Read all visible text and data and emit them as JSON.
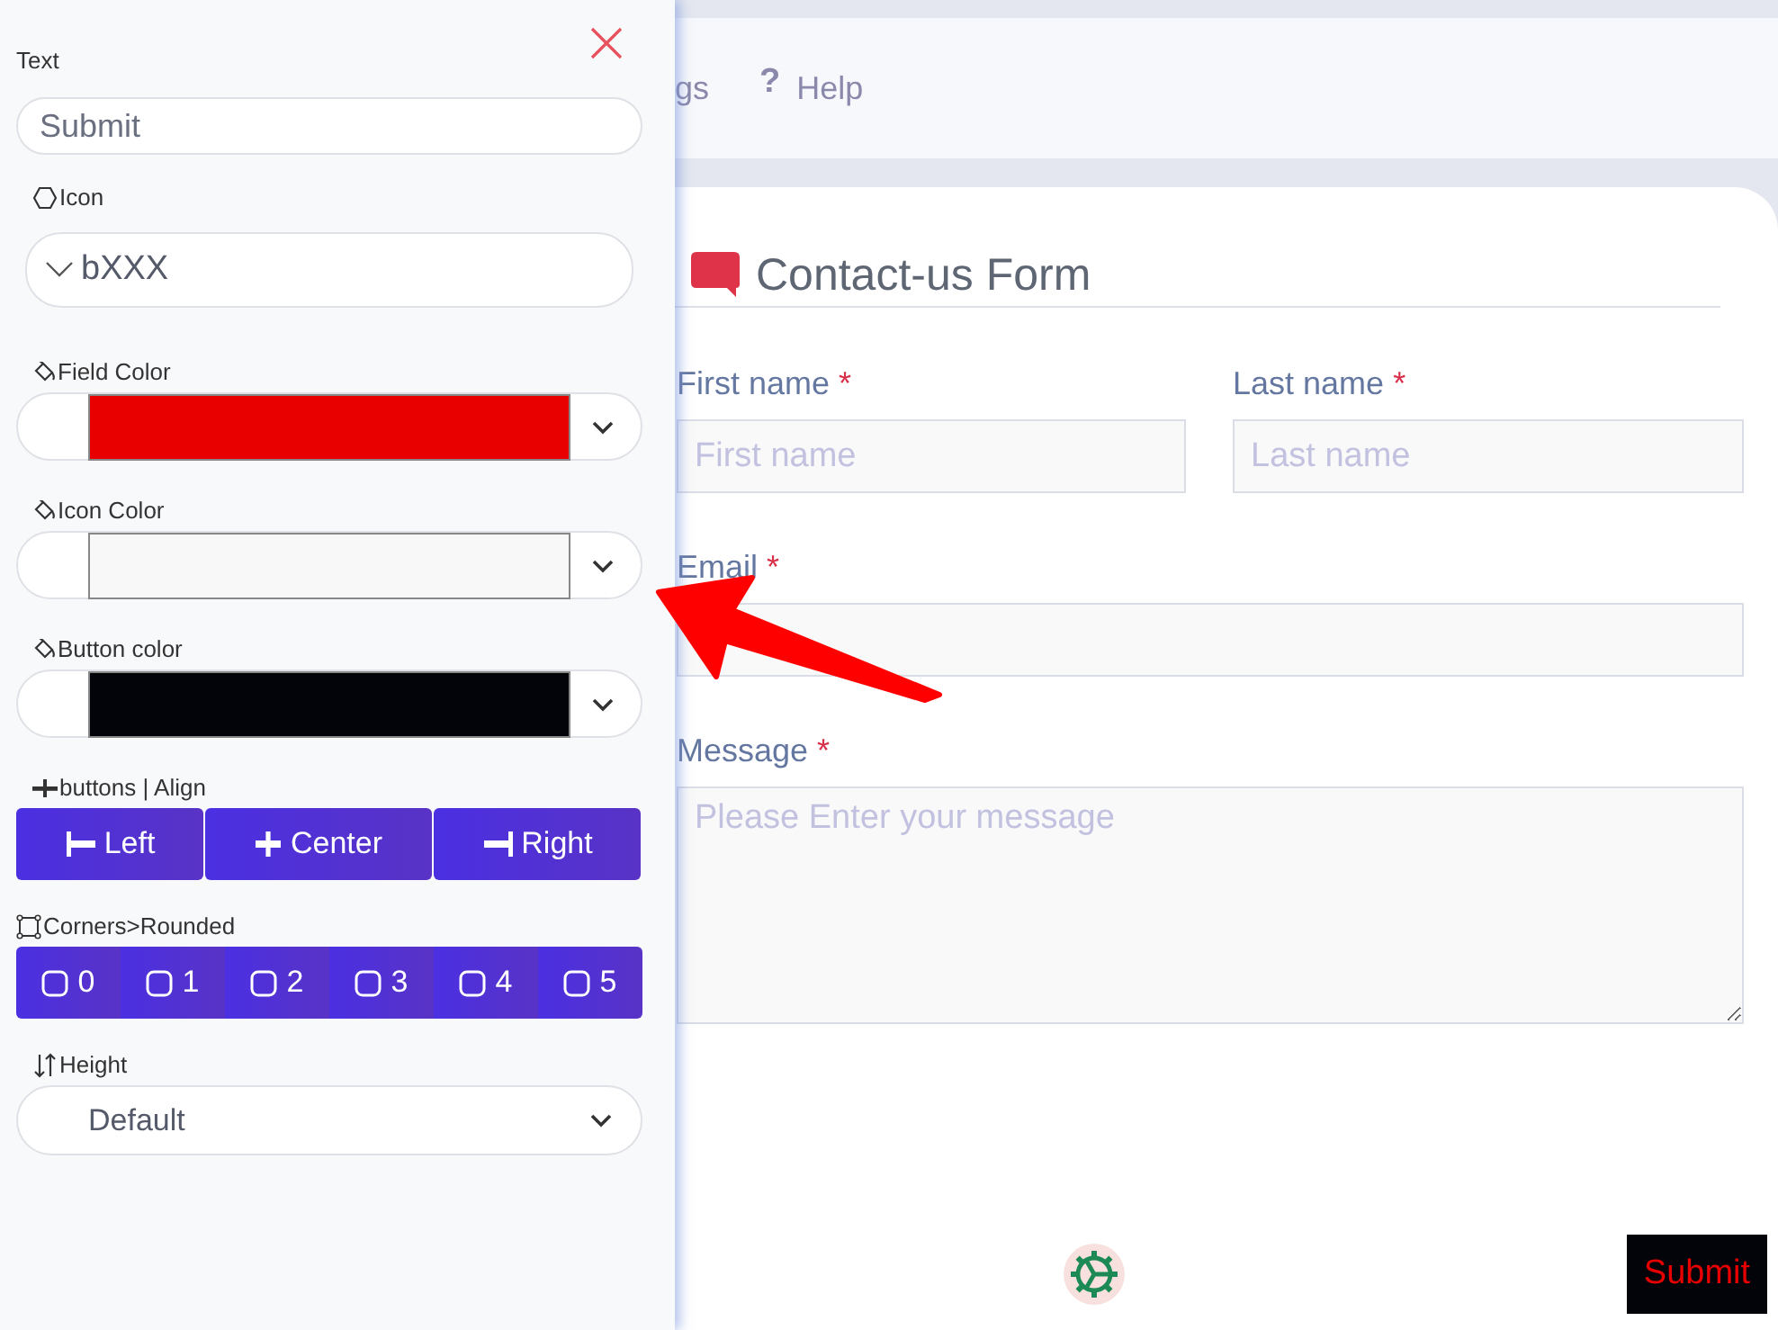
{
  "panel": {
    "text_field": {
      "label": "Text",
      "value": "Submit"
    },
    "icon_select": {
      "label": "Icon",
      "value": "bXXX"
    },
    "colors": [
      {
        "label": "Field Color",
        "color": "#e80000"
      },
      {
        "label": "Icon Color",
        "color": "#f8f8f8"
      },
      {
        "label": "Button color",
        "color": "#03040a"
      }
    ],
    "align": {
      "label": "buttons | Align",
      "buttons": [
        {
          "kind": "left",
          "label": "Left"
        },
        {
          "kind": "center",
          "label": "Center"
        },
        {
          "kind": "right",
          "label": "Right"
        }
      ]
    },
    "corners": {
      "label": "Corners>Rounded",
      "options": [
        "0",
        "1",
        "2",
        "3",
        "4",
        "5"
      ]
    },
    "height": {
      "label": "Height",
      "value": "Default"
    }
  },
  "nav": [
    {
      "label": "gs"
    },
    {
      "icon": "?",
      "label": "Help"
    }
  ],
  "form": {
    "title": "Contact-us Form",
    "fields": [
      {
        "kind": "input",
        "label": "First name",
        "marker": "*",
        "placeholder": "First name"
      },
      {
        "kind": "input",
        "label": "Last name",
        "marker": "*",
        "placeholder": "Last name"
      },
      {
        "kind": "input",
        "label": "Email",
        "marker": "*",
        "wide": true
      },
      {
        "kind": "textarea",
        "label": "Message",
        "marker": "*",
        "placeholder": "Please Enter your message",
        "wide": true
      }
    ],
    "submit": "Submit"
  }
}
